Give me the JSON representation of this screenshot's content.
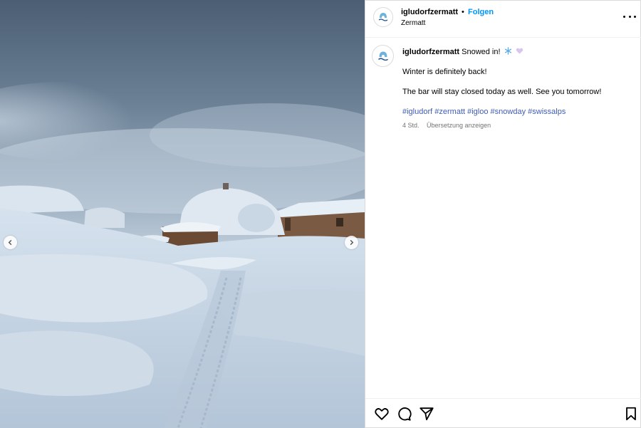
{
  "post": {
    "username": "igludorfzermatt",
    "separator": "•",
    "follow_label": "Folgen",
    "location": "Zermatt"
  },
  "caption": {
    "username": "igludorfzermatt",
    "title": "Snowed in!",
    "emojis": [
      "snowflake-emoji",
      "light-purple-heart-emoji"
    ],
    "line1": "Winter is definitely back!",
    "line2": "The bar will stay closed today as well. See you tomorrow!",
    "hashtags": [
      "#igludorf",
      "#zermatt",
      "#igloo",
      "#snowday",
      "#swissalps"
    ],
    "time": "4 Std.",
    "translate_label": "Übersetzung anzeigen"
  },
  "icons": {
    "avatar": "igloo-logo",
    "more": "more-options-icon",
    "prev": "chevron-left-icon",
    "next": "chevron-right-icon",
    "like": "heart-icon",
    "comment": "comment-icon",
    "share": "share-icon",
    "save": "bookmark-icon"
  },
  "colors": {
    "follow": "#0095f6",
    "hashtag": "#3f5cb5",
    "meta": "#737373",
    "border": "#dbdbdb"
  }
}
